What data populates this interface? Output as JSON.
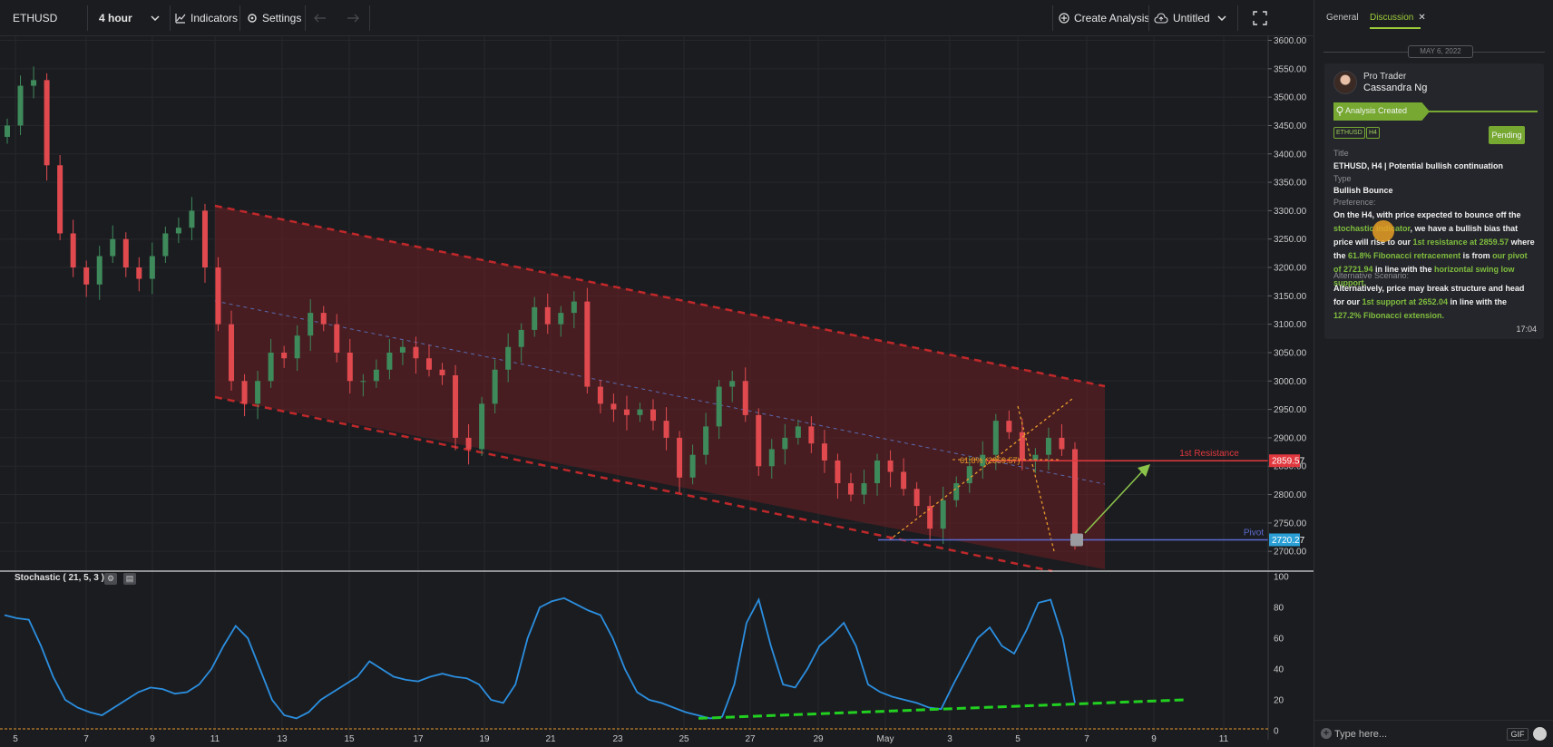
{
  "toolbar": {
    "symbol": "ETHUSD",
    "interval": "4 hour",
    "indicators_label": "Indicators",
    "settings_label": "Settings",
    "create_analysis_label": "Create Analysis",
    "layout_name": "Untitled"
  },
  "chart_data": [
    {
      "type": "candlestick",
      "symbol": "ETHUSD",
      "interval": "4 hour",
      "y_axis": {
        "ylim": [
          2650,
          3600
        ],
        "ticks": [
          3600,
          3550,
          3500,
          3450,
          3400,
          3350,
          3300,
          3250,
          3200,
          3150,
          3100,
          3050,
          3000,
          2950,
          2900,
          2850,
          2800,
          2750,
          2700
        ]
      },
      "x_axis": {
        "ticks": [
          "5",
          "7",
          "9",
          "11",
          "13",
          "15",
          "17",
          "19",
          "21",
          "23",
          "25",
          "27",
          "29",
          "May",
          "3",
          "5",
          "7",
          "9",
          "11"
        ]
      },
      "closes": [
        3450,
        3520,
        3530,
        3380,
        3260,
        3200,
        3170,
        3220,
        3250,
        3200,
        3180,
        3220,
        3260,
        3270,
        3300,
        3200,
        3100,
        3000,
        2960,
        3000,
        3050,
        3040,
        3080,
        3120,
        3100,
        3050,
        3000,
        3000,
        3020,
        3050,
        3060,
        3040,
        3020,
        3010,
        2900,
        2880,
        2960,
        3020,
        3060,
        3090,
        3130,
        3100,
        3120,
        3140,
        2990,
        2960,
        2950,
        2940,
        2950,
        2930,
        2900,
        2830,
        2870,
        2920,
        2990,
        3000,
        2940,
        2850,
        2880,
        2900,
        2920,
        2890,
        2860,
        2820,
        2800,
        2820,
        2860,
        2840,
        2810,
        2780,
        2740,
        2790,
        2820,
        2850,
        2870,
        2930,
        2910,
        2860,
        2870,
        2900,
        2880,
        2720
      ],
      "annotations": [
        {
          "text": "1st Resistance",
          "price": 2859.57,
          "price_label": "2859.57",
          "color": "#e0383e"
        },
        {
          "text": "Pivot",
          "price": 2720.27,
          "price_label": "2720.27",
          "color": "#5b6bd0"
        },
        {
          "text": "61.8% (2859.57)",
          "type": "fibonacci"
        }
      ],
      "channel": {
        "type": "descending",
        "color": "#c0282a"
      }
    },
    {
      "type": "line",
      "title": "Stochastic ( 21, 5, 3 )",
      "ylim": [
        0,
        100
      ],
      "y_ticks": [
        100,
        80,
        60,
        40,
        20,
        0
      ],
      "values": [
        75,
        73,
        72,
        55,
        35,
        20,
        15,
        12,
        10,
        15,
        20,
        25,
        28,
        27,
        24,
        25,
        30,
        40,
        55,
        68,
        60,
        40,
        20,
        10,
        8,
        12,
        20,
        25,
        30,
        35,
        45,
        40,
        35,
        33,
        32,
        35,
        37,
        35,
        34,
        30,
        20,
        18,
        30,
        60,
        80,
        84,
        86,
        82,
        78,
        75,
        60,
        40,
        25,
        20,
        18,
        15,
        12,
        10,
        8,
        9,
        30,
        70,
        85,
        55,
        30,
        28,
        40,
        55,
        62,
        70,
        55,
        30,
        25,
        22,
        20,
        18,
        15,
        14,
        30,
        45,
        60,
        67,
        55,
        50,
        65,
        83,
        85,
        60,
        18
      ],
      "trendline": {
        "color": "#22d020",
        "style": "dashed"
      }
    }
  ],
  "panel": {
    "tabs": [
      "General",
      "Discussion"
    ],
    "active_tab": "Discussion",
    "date_separator": "MAY 6, 2022",
    "author_role": "Pro Trader",
    "author_name": "Cassandra Ng",
    "status_banner": "Analysis Created",
    "tags": [
      "ETHUSD",
      "H4"
    ],
    "status": "Pending",
    "title_label": "Title",
    "title_value": "ETHUSD, H4 | Potential bullish continuation",
    "type_label": "Type",
    "type_value": "Bullish Bounce",
    "preference_label": "Preference:",
    "preference_text": {
      "p1": "On the H4, with price expected to bounce off the ",
      "g1": "stochastic indicator",
      "p2": ", we have a bullish bias that price will rise to our ",
      "g2": "1st resistance at 2859.57",
      "p3": " where the ",
      "g3": "61.8% Fibonacci retracement",
      "p4": " is from ",
      "g4": "our pivot of 2721.94",
      "p5": " in line with the ",
      "g5": "horizontal swing low support."
    },
    "alt_label": "Alternative Scenario:",
    "alt_text": {
      "p1": "Alternatively, price may break structure and head for our ",
      "g1": "1st support at 2652.04",
      "p2": " in line with the ",
      "g2": "127.2% Fibonacci extension."
    },
    "time": "17:04",
    "message_placeholder": "Type here...",
    "gif_label": "GIF"
  },
  "colors": {
    "bull": "#3e8a5b",
    "bear": "#e04a4f",
    "accent": "#76a832",
    "stoch_line": "#2b8fe0",
    "background": "#1b1c20"
  }
}
